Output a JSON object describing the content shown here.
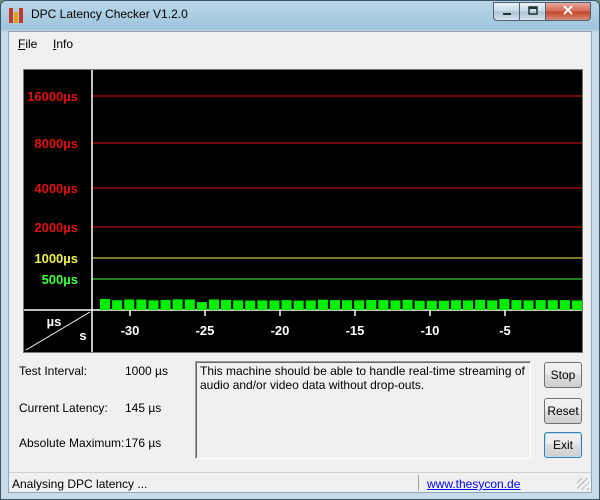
{
  "window": {
    "title": "DPC Latency Checker V1.2.0",
    "controls": {
      "minimize": "0",
      "maximize": "1",
      "close": "r"
    }
  },
  "menu": {
    "items": [
      {
        "key": "F",
        "rest": "ile"
      },
      {
        "key": "I",
        "rest": "nfo"
      }
    ]
  },
  "graph": {
    "y_labels": [
      {
        "text": "16000µs",
        "color": "#e01010"
      },
      {
        "text": "8000µs",
        "color": "#e01010"
      },
      {
        "text": "4000µs",
        "color": "#e01010"
      },
      {
        "text": "2000µs",
        "color": "#e01010"
      },
      {
        "text": "1000µs",
        "color": "#f0f050"
      },
      {
        "text": "500µs",
        "color": "#40ff40"
      }
    ],
    "axis_unit_top": "µs",
    "axis_unit_bottom": "s",
    "x_labels": [
      "-30",
      "-25",
      "-20",
      "-15",
      "-10",
      "-5"
    ],
    "bar_color": "#00ee00",
    "bars": [
      178,
      158,
      170,
      168,
      156,
      163,
      172,
      170,
      128,
      170,
      164,
      156,
      152,
      155,
      154,
      160,
      152,
      155,
      166,
      160,
      158,
      156,
      162,
      160,
      156,
      163,
      150,
      150,
      150,
      158,
      154,
      163,
      156,
      176,
      160,
      155,
      160,
      158,
      160,
      154
    ]
  },
  "stats": {
    "test_interval_label": "Test Interval:",
    "test_interval_value": "1000 µs",
    "current_latency_label": "Current Latency:",
    "current_latency_value": "145 µs",
    "absolute_max_label": "Absolute Maximum:",
    "absolute_max_value": "176 µs"
  },
  "message": "This machine should be able to handle real-time streaming of audio and/or video data without drop-outs.",
  "buttons": {
    "stop": "Stop",
    "reset": "Reset",
    "exit": "Exit"
  },
  "status": {
    "text": "Analysing DPC latency ...",
    "link": "www.thesycon.de"
  }
}
